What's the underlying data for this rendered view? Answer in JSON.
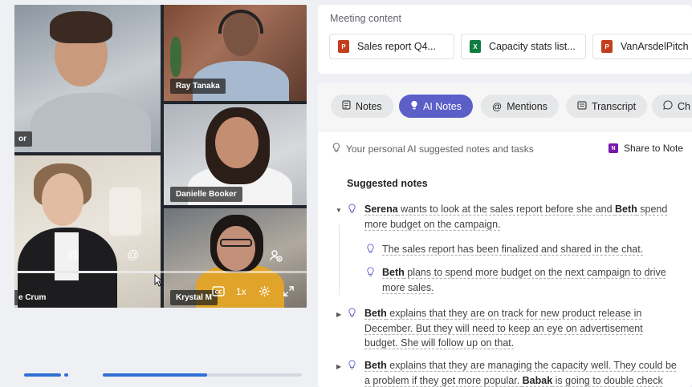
{
  "video": {
    "participants": [
      {
        "name": "or"
      },
      {
        "name": "Ray Tanaka"
      },
      {
        "name": "Danielle Booker"
      },
      {
        "name": "e Crum"
      },
      {
        "name": "Krystal M"
      }
    ],
    "controls": {
      "speed": "1x"
    }
  },
  "meeting_content": {
    "title": "Meeting content",
    "files": [
      {
        "label": "Sales report Q4...",
        "type": "P",
        "color": "#c43e1c"
      },
      {
        "label": "Capacity stats list...",
        "type": "X",
        "color": "#107c41"
      },
      {
        "label": "VanArsdelPitch",
        "type": "P",
        "color": "#c43e1c"
      }
    ]
  },
  "tabs": [
    {
      "label": "Notes",
      "icon": "notes-icon"
    },
    {
      "label": "AI Notes",
      "icon": "lightbulb-icon"
    },
    {
      "label": "Mentions",
      "icon": "at-icon"
    },
    {
      "label": "Transcript",
      "icon": "transcript-icon"
    },
    {
      "label": "Ch",
      "icon": "chat-icon"
    }
  ],
  "ai_hint": "Your personal AI suggested notes and tasks",
  "share_label": "Share to Note",
  "suggested_title": "Suggested notes",
  "notes": {
    "n1": {
      "who": "Serena",
      "mid": " wants to look at the sales report before she and ",
      "who2": "Beth",
      "tail": " spend",
      "line2": "more budget on the campaign."
    },
    "n1a": "The sales report has been finalized and shared in the chat.",
    "n1b": {
      "who": "Beth",
      "text": " plans to spend more budget on the next campaign to drive",
      "line2": "more sales."
    },
    "n2": {
      "who": "Beth",
      "text": " explains that they are on track for new product release in",
      "line2": "December. But they will need to keep an eye on advertisement",
      "line3": "budget. She will follow up on that."
    },
    "n3": {
      "who": "Beth",
      "text": " explains that they are managing the capacity well. They could be",
      "line2a": "a problem if they get more popular. ",
      "who2": "Babak",
      "line2b": " is going to double check"
    }
  },
  "colors": {
    "accent": "#5b5fc7",
    "progress": "#2f6fd6"
  }
}
